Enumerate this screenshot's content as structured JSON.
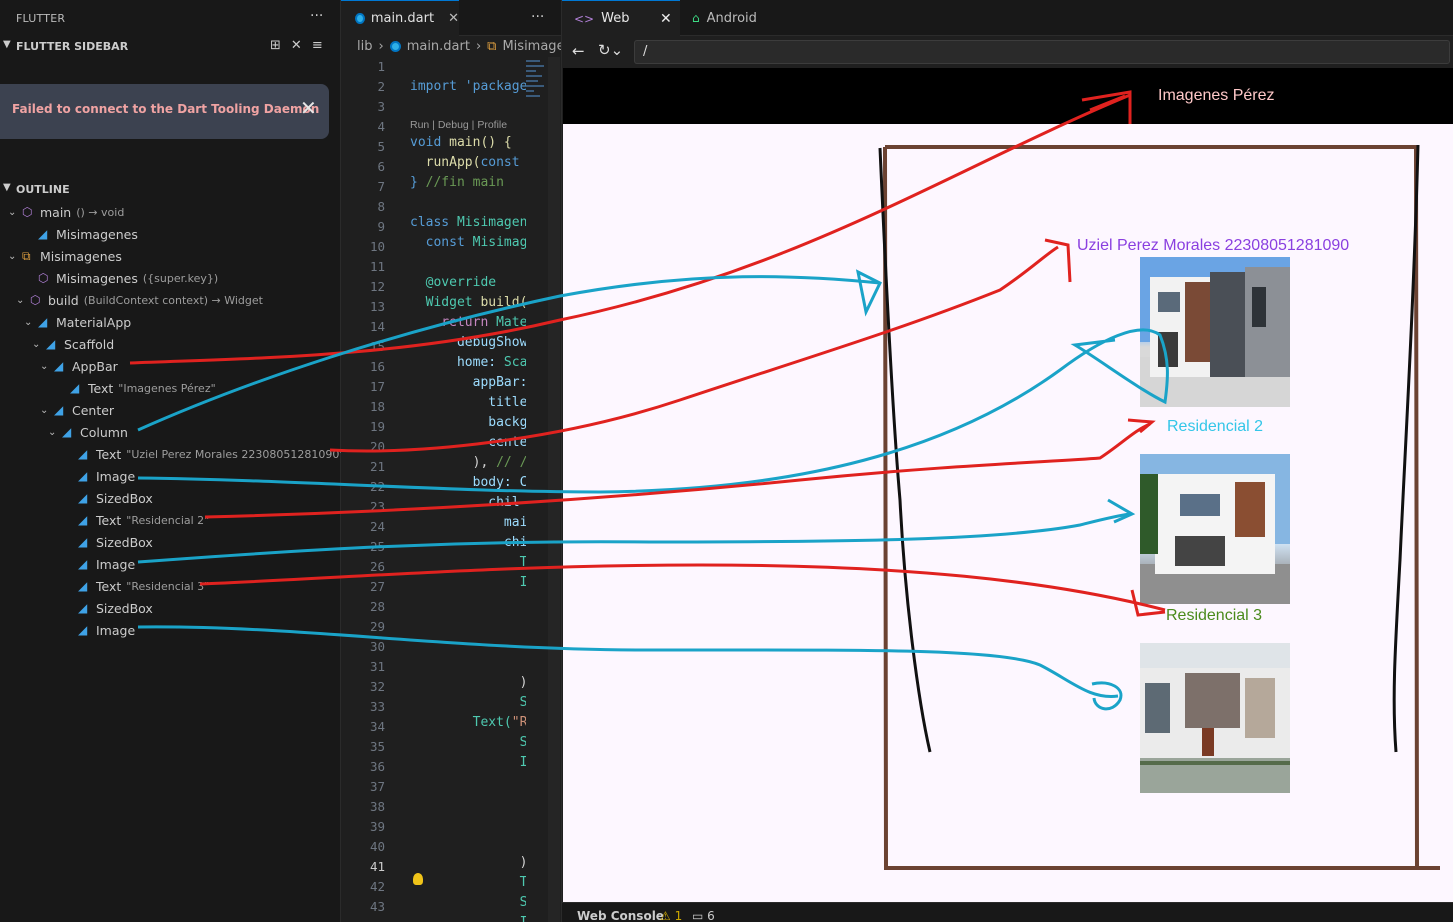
{
  "sidebar": {
    "panel_title": "FLUTTER",
    "more_label": "···",
    "section_label": "FLUTTER SIDEBAR",
    "notification": "Failed to connect to the Dart Tooling Daemon",
    "outline_label": "OUTLINE",
    "tree": [
      {
        "label": "main",
        "sub": "() → void",
        "icon": "cube-icon"
      },
      {
        "label": "Misimagenes",
        "sub": "",
        "icon": "flutter-icon"
      },
      {
        "label": "Misimagenes",
        "sub": "",
        "icon": "class-icon"
      },
      {
        "label": "Misimagenes",
        "sub": "({super.key})",
        "icon": "cube-icon"
      },
      {
        "label": "build",
        "sub": "(BuildContext context) → Widget",
        "icon": "cube-icon"
      },
      {
        "label": "MaterialApp",
        "sub": "",
        "icon": "flutter-icon"
      },
      {
        "label": "Scaffold",
        "sub": "",
        "icon": "flutter-icon"
      },
      {
        "label": "AppBar",
        "sub": "",
        "icon": "flutter-icon"
      },
      {
        "label": "Text",
        "sub": "\"Imagenes Pérez\"",
        "icon": "flutter-icon"
      },
      {
        "label": "Center",
        "sub": "",
        "icon": "flutter-icon"
      },
      {
        "label": "Column",
        "sub": "",
        "icon": "flutter-icon"
      },
      {
        "label": "Text",
        "sub": "\"Uziel Perez Morales 22308051281090\"",
        "icon": "flutter-icon"
      },
      {
        "label": "Image",
        "sub": "",
        "icon": "flutter-icon"
      },
      {
        "label": "SizedBox",
        "sub": "",
        "icon": "flutter-icon"
      },
      {
        "label": "Text",
        "sub": "\"Residencial 2\"",
        "icon": "flutter-icon"
      },
      {
        "label": "SizedBox",
        "sub": "",
        "icon": "flutter-icon"
      },
      {
        "label": "Image",
        "sub": "",
        "icon": "flutter-icon"
      },
      {
        "label": "Text",
        "sub": "\"Residencial 3\"",
        "icon": "flutter-icon"
      },
      {
        "label": "SizedBox",
        "sub": "",
        "icon": "flutter-icon"
      },
      {
        "label": "Image",
        "sub": "",
        "icon": "flutter-icon"
      }
    ]
  },
  "editor": {
    "tab_label": "main.dart",
    "more_label": "···",
    "breadcrumb": {
      "folder": "lib",
      "file": "main.dart",
      "symbol": "Misimagen"
    },
    "line_numbers": [
      "1",
      "2",
      "3",
      "4",
      "5",
      "6",
      "7",
      "8",
      "9",
      "10",
      "11",
      "12",
      "13",
      "14",
      "15",
      "16",
      "17",
      "18",
      "19",
      "20",
      "21",
      "22",
      "23",
      "24",
      "25",
      "26",
      "27",
      "28",
      "29",
      "30",
      "31",
      "32",
      "33",
      "34",
      "35",
      "36",
      "37",
      "38",
      "39",
      "40",
      "41",
      "42",
      "43"
    ],
    "current_line": "41",
    "codelens": "Run | Debug | Profile",
    "code": {
      "l2": "import 'package",
      "l4a": "void",
      "l4b": " main() {",
      "l5a": "  runApp(",
      "l5b": "const",
      "l6a": "} ",
      "l6b": "//fin main",
      "l8a": "class",
      "l8b": " Misimagen",
      "l9a": "  const",
      "l9b": " Misimag",
      "l11": "  @override",
      "l12a": "  Widget",
      "l12b": " build(",
      "l13a": "    return",
      "l13b": " Mate",
      "l14": "      debugShow",
      "l15a": "      home: ",
      "l15b": "Sca",
      "l16": "        appBar:",
      "l17": "          title",
      "l18": "          backg",
      "l19": "          cente",
      "l20a": "        ), ",
      "l20b": "// /",
      "l21": "        body: C",
      "l22": "          chil",
      "l23": "            mai",
      "l24": "            chi",
      "l25": "              T",
      "l26": "              I",
      "l31": "              )",
      "l32": "              S",
      "l33a": "        Text(",
      "l33b": "\"R",
      "l34": "              S",
      "l35": "              I",
      "l40": "              )",
      "l41": "              T",
      "l42": "              S",
      "l43": "              I"
    }
  },
  "preview": {
    "tab_web": "Web",
    "tab_android": "Android",
    "url": "/",
    "console_label": "Web Console",
    "warnings": "1",
    "messages": "6"
  },
  "app": {
    "appbar_title": "Imagenes Pérez",
    "name_text": "Uziel Perez Morales 22308051281090",
    "res2_text": "Residencial 2",
    "res3_text": "Residencial 3",
    "colors": {
      "appbar_bg": "#000000",
      "title": "#ffc8c8",
      "name": "#8a3fe0",
      "res2": "#34c6e8",
      "res3": "#4a8a1c",
      "body_bg": "#fdf7ff"
    }
  }
}
